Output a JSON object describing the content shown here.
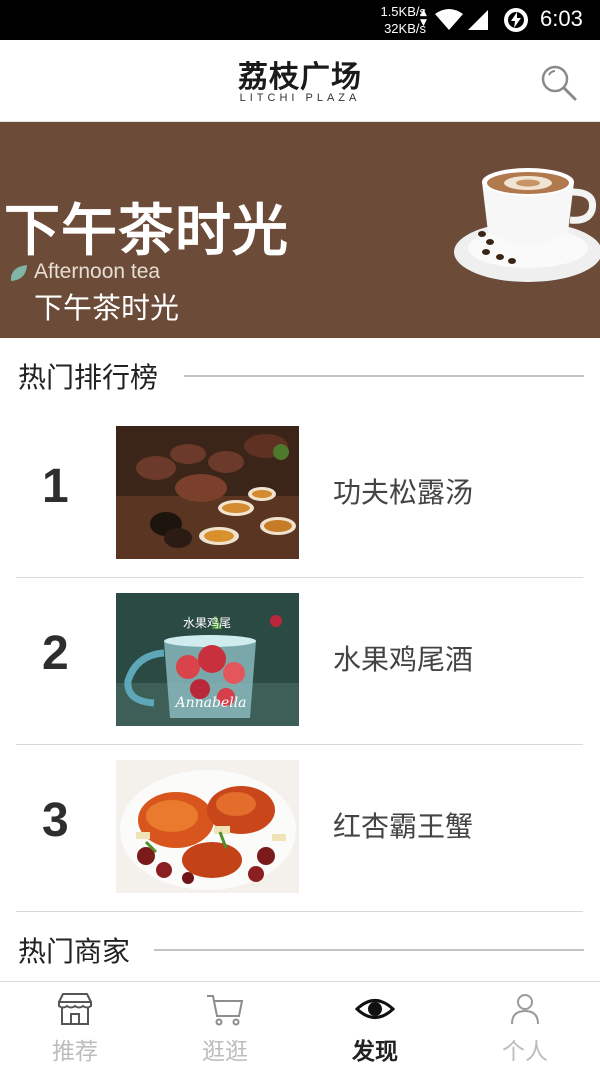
{
  "status_bar": {
    "net_up": "1.5KB/s",
    "net_down": "32KB/s",
    "time": "6:03"
  },
  "header": {
    "title": "荔枝广场",
    "subtitle": "LITCHI PLAZA",
    "search_icon": "search-icon"
  },
  "banner": {
    "title": "下午茶时光",
    "english": "Afternoon tea",
    "subtitle": "下午茶时光",
    "background_color": "#6c4c38"
  },
  "ranking": {
    "title": "热门排行榜",
    "items": [
      {
        "rank": "1",
        "name": "功夫松露汤"
      },
      {
        "rank": "2",
        "name": "水果鸡尾酒",
        "image_text": "水果鸡尾",
        "image_script": "Annabella"
      },
      {
        "rank": "3",
        "name": "红杏霸王蟹"
      }
    ]
  },
  "merchants": {
    "title": "热门商家"
  },
  "bottom_nav": {
    "items": [
      {
        "label": "推荐",
        "icon": "shop-icon",
        "active": false
      },
      {
        "label": "逛逛",
        "icon": "cart-icon",
        "active": false
      },
      {
        "label": "发现",
        "icon": "eye-icon",
        "active": true
      },
      {
        "label": "个人",
        "icon": "person-icon",
        "active": false
      }
    ]
  }
}
